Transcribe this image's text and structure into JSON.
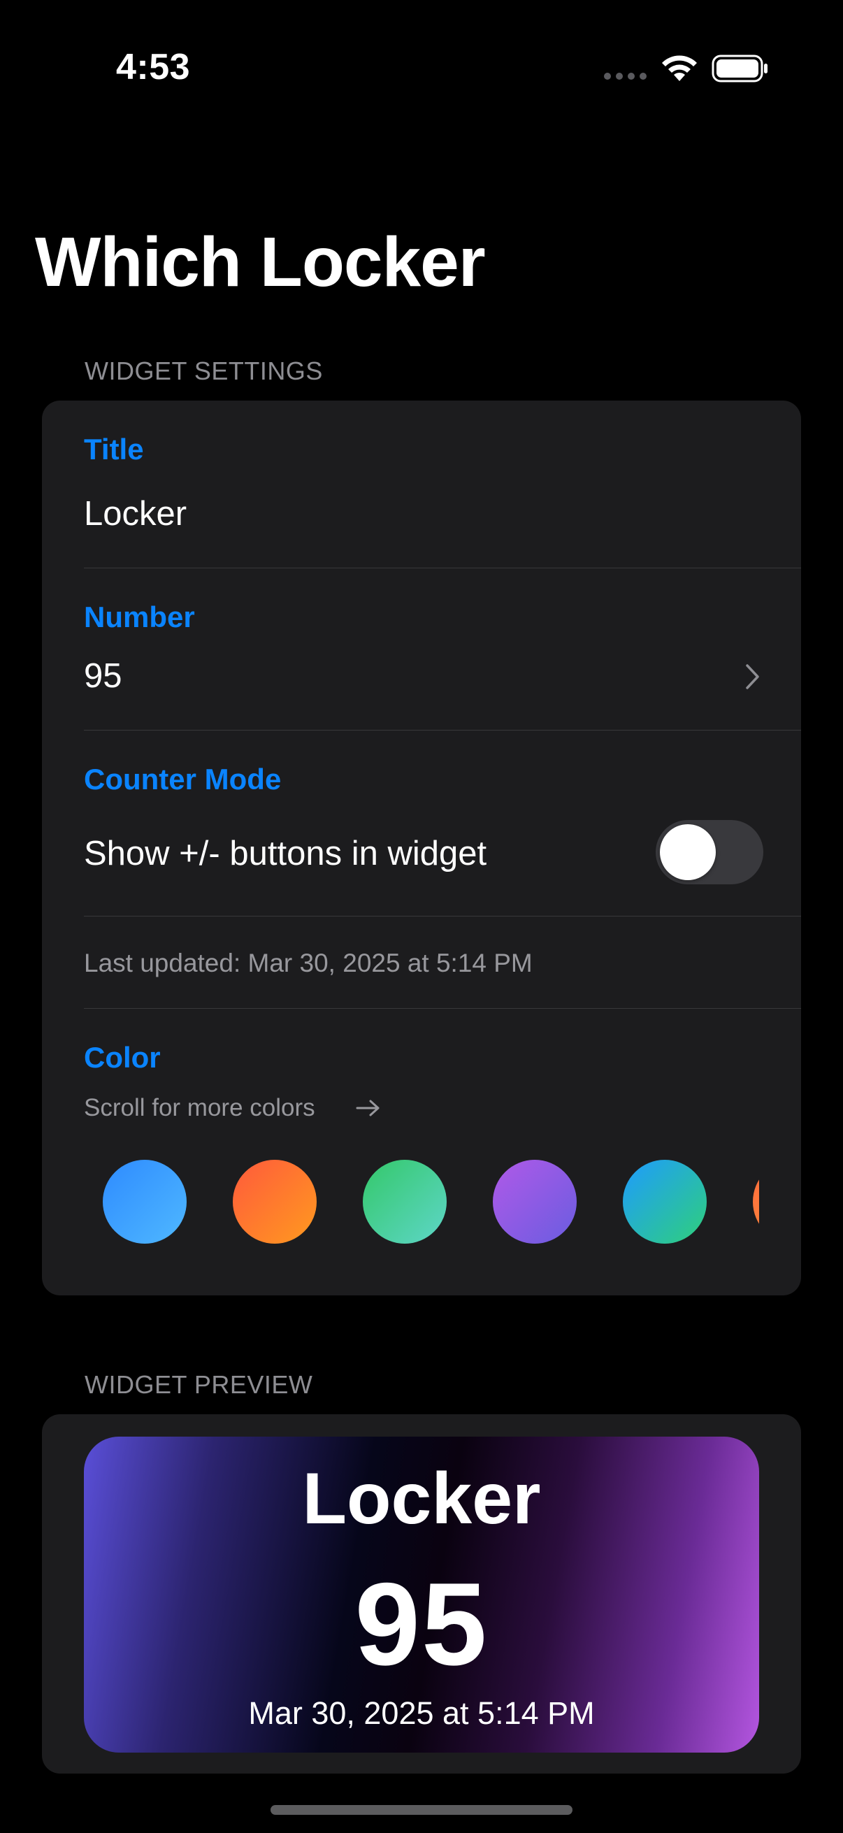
{
  "status_bar": {
    "time": "4:53",
    "icons": [
      "signal-dots-icon",
      "wifi-icon",
      "battery-icon"
    ]
  },
  "page": {
    "title": "Which Locker"
  },
  "widget_settings": {
    "header": "WIDGET SETTINGS",
    "title_field": {
      "label": "Title",
      "value": "Locker"
    },
    "number_field": {
      "label": "Number",
      "value": "95"
    },
    "counter_mode": {
      "label": "Counter Mode",
      "toggle_label": "Show +/- buttons in widget",
      "enabled": false
    },
    "last_updated": "Last updated: Mar 30, 2025 at 5:14 PM",
    "color": {
      "label": "Color",
      "hint": "Scroll for more colors",
      "swatches": [
        {
          "name": "blue",
          "from": "#2e8bff",
          "to": "#4fb8ff"
        },
        {
          "name": "orange",
          "from": "#ff5a3c",
          "to": "#ff9a1f"
        },
        {
          "name": "green",
          "from": "#34c86a",
          "to": "#5ed6c8"
        },
        {
          "name": "purple",
          "from": "#b05ae8",
          "to": "#6a5ce0"
        },
        {
          "name": "teal",
          "from": "#1e9bff",
          "to": "#2fd07a"
        },
        {
          "name": "coral",
          "from": "#ff6a3c",
          "to": "#ff9a3c"
        }
      ]
    }
  },
  "widget_preview": {
    "header": "WIDGET PREVIEW",
    "title": "Locker",
    "number": "95",
    "date": "Mar 30, 2025 at 5:14 PM"
  },
  "colors": {
    "accent": "#0a84ff",
    "card": "#1c1c1e",
    "background": "#000000"
  }
}
